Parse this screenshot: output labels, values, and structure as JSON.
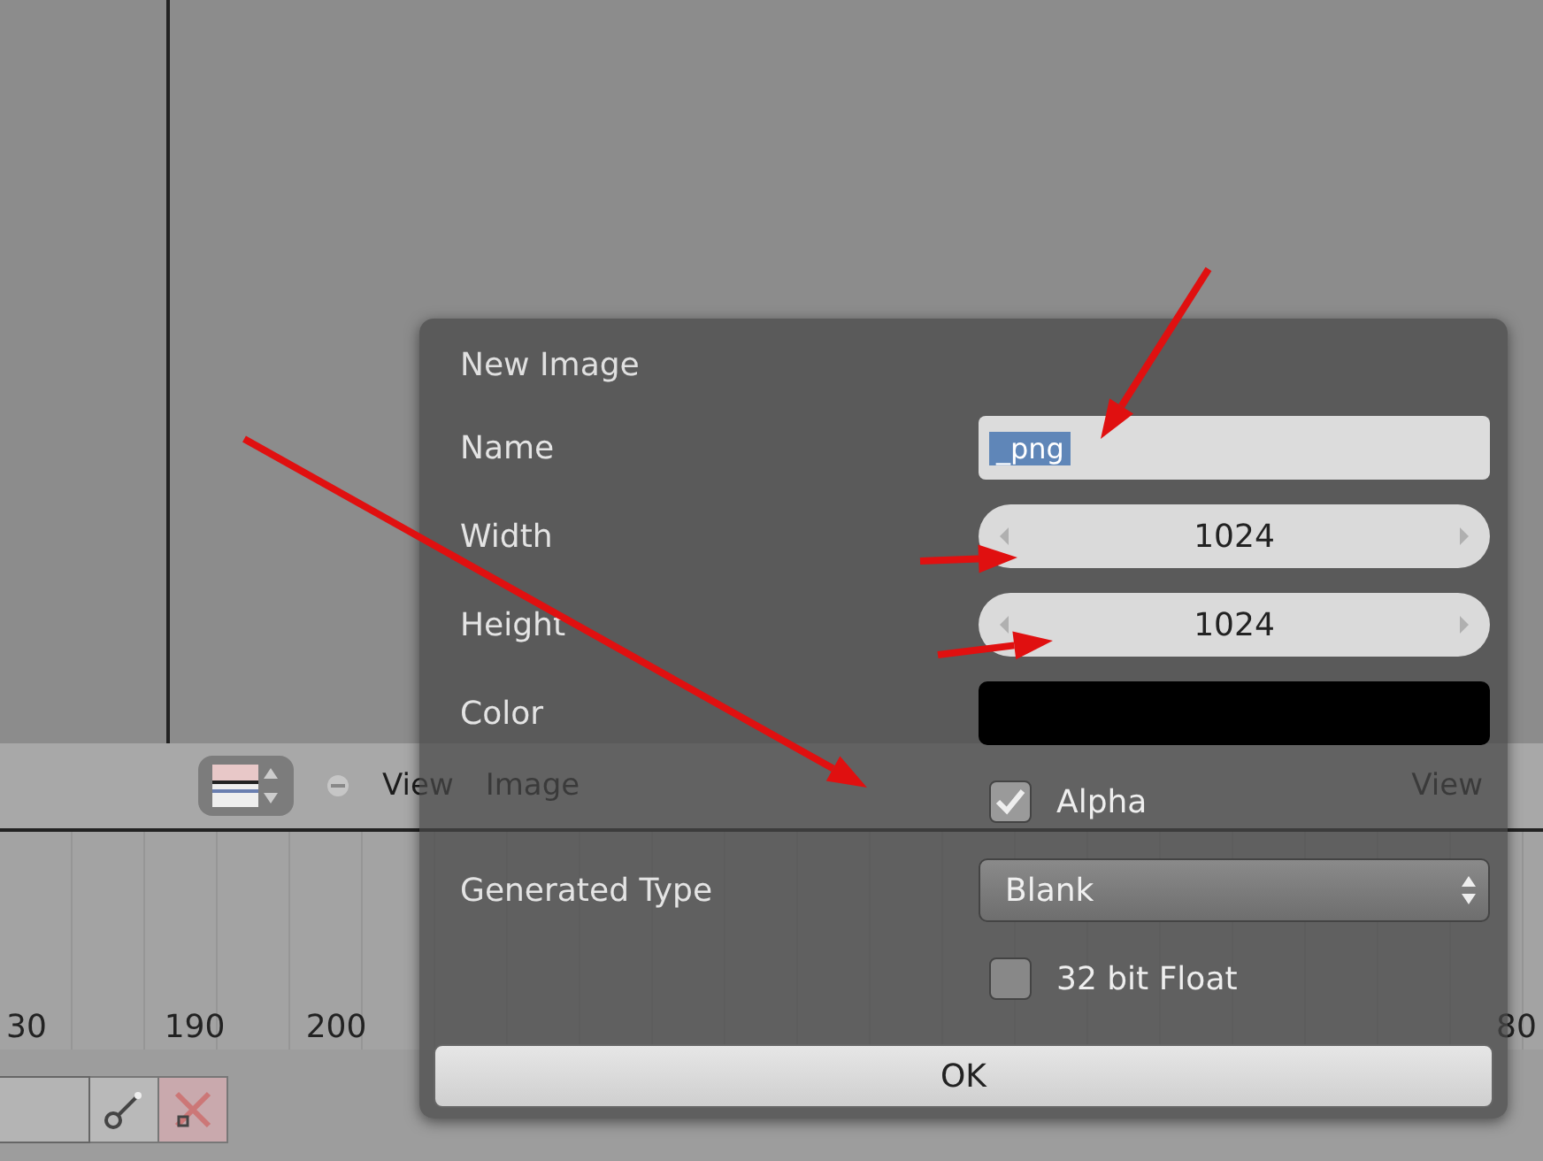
{
  "header": {
    "menus": [
      "View",
      "Image"
    ],
    "right_menu": "View"
  },
  "timeline": {
    "ticks": [
      "30",
      "190",
      "200"
    ],
    "edge_tick": "80"
  },
  "dialog": {
    "title": "New Image",
    "fields": [
      {
        "kind": "text",
        "label": "Name",
        "value": "_png"
      },
      {
        "kind": "number",
        "label": "Width",
        "value": "1024"
      },
      {
        "kind": "number",
        "label": "Height",
        "value": "1024"
      },
      {
        "kind": "color",
        "label": "Color",
        "color": "#000000"
      },
      {
        "kind": "checkbox",
        "label": "Alpha",
        "checked": true
      },
      {
        "kind": "select",
        "label": "Generated Type",
        "value": "Blank"
      },
      {
        "kind": "checkbox",
        "label": "32 bit Float",
        "checked": false
      }
    ],
    "ok": "OK"
  },
  "arrows": [
    {
      "kind": "arrow"
    },
    {
      "kind": "arrow"
    },
    {
      "kind": "arrow"
    },
    {
      "kind": "arrow"
    }
  ]
}
